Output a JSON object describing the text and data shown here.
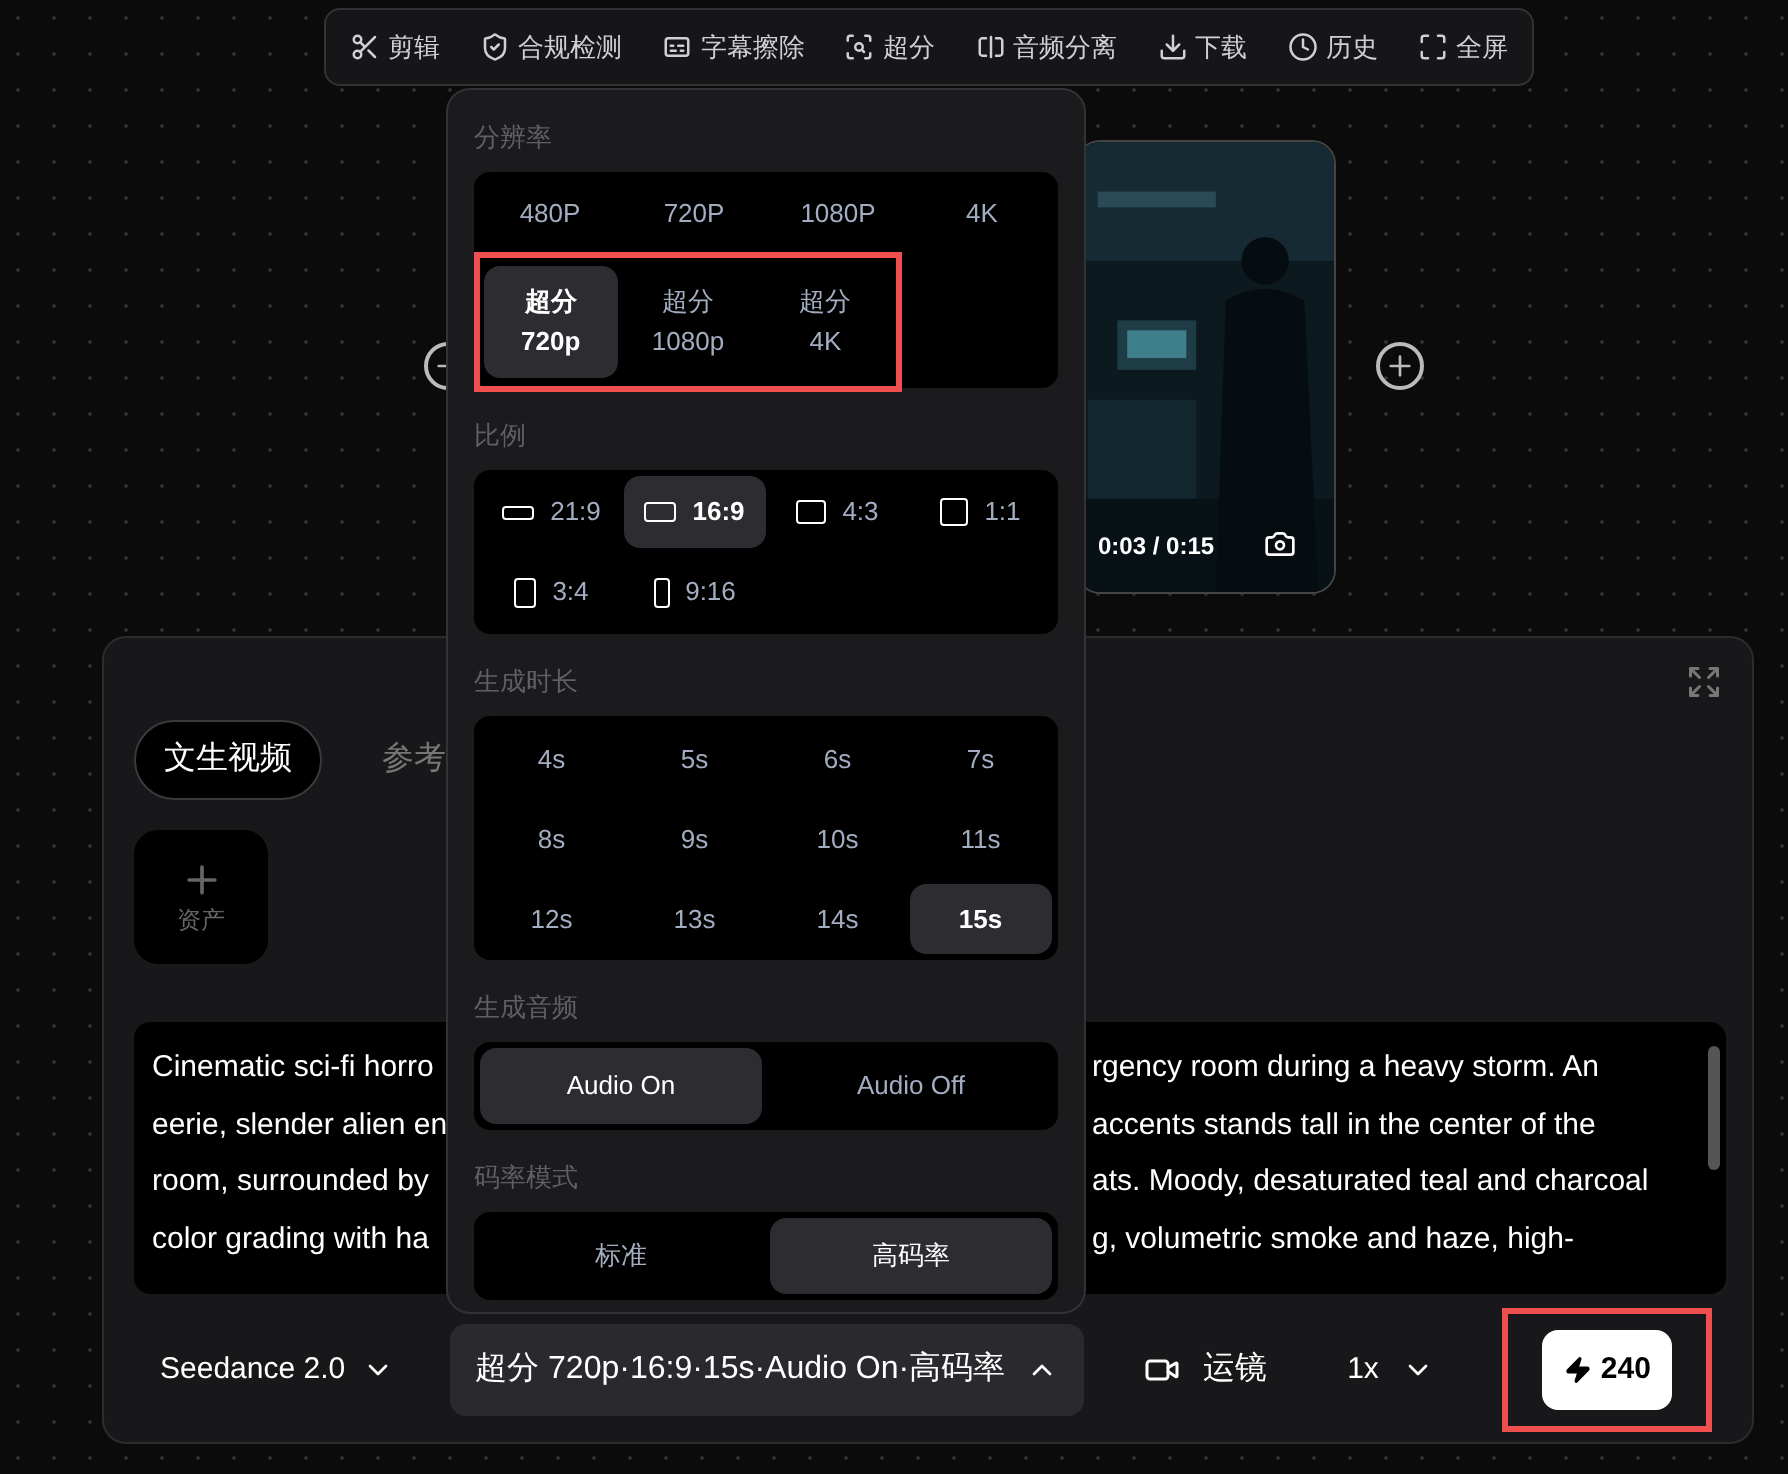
{
  "toolbar": [
    {
      "label": "剪辑"
    },
    {
      "label": "合规检测"
    },
    {
      "label": "字幕擦除"
    },
    {
      "label": "超分"
    },
    {
      "label": "音频分离"
    },
    {
      "label": "下载"
    },
    {
      "label": "历史"
    },
    {
      "label": "全屏"
    }
  ],
  "preview": {
    "time": "0:03 / 0:15"
  },
  "settings_menu": {
    "resolution": {
      "title": "分辨率",
      "options": [
        {
          "label": "480P",
          "selected": false
        },
        {
          "label": "720P",
          "selected": false
        },
        {
          "label": "1080P",
          "selected": false
        },
        {
          "label": "4K",
          "selected": false
        }
      ],
      "upscale": {
        "highlighted": true,
        "options": [
          {
            "label": "超分",
            "sublabel": "720p",
            "selected": true
          },
          {
            "label": "超分",
            "sublabel": "1080p",
            "selected": false
          },
          {
            "label": "超分",
            "sublabel": "4K",
            "selected": false
          }
        ]
      }
    },
    "aspect": {
      "title": "比例",
      "options": [
        {
          "label": "21:9",
          "selected": false
        },
        {
          "label": "16:9",
          "selected": true
        },
        {
          "label": "4:3",
          "selected": false
        },
        {
          "label": "1:1",
          "selected": false
        },
        {
          "label": "3:4",
          "selected": false
        },
        {
          "label": "9:16",
          "selected": false
        }
      ]
    },
    "duration": {
      "title": "生成时长",
      "options": [
        {
          "label": "4s",
          "selected": false
        },
        {
          "label": "5s",
          "selected": false
        },
        {
          "label": "6s",
          "selected": false
        },
        {
          "label": "7s",
          "selected": false
        },
        {
          "label": "8s",
          "selected": false
        },
        {
          "label": "9s",
          "selected": false
        },
        {
          "label": "10s",
          "selected": false
        },
        {
          "label": "11s",
          "selected": false
        },
        {
          "label": "12s",
          "selected": false
        },
        {
          "label": "13s",
          "selected": false
        },
        {
          "label": "14s",
          "selected": false
        },
        {
          "label": "15s",
          "selected": true
        }
      ]
    },
    "audio": {
      "title": "生成音频",
      "options": [
        {
          "label": "Audio On",
          "selected": true
        },
        {
          "label": "Audio Off",
          "selected": false
        }
      ]
    },
    "bitrate": {
      "title": "码率模式",
      "options": [
        {
          "label": "标准",
          "selected": false
        },
        {
          "label": "高码率",
          "selected": true
        }
      ]
    }
  },
  "mode_tabs": [
    {
      "label": "文生视频",
      "selected": true
    },
    {
      "label": "参考",
      "selected": false
    }
  ],
  "asset_button": {
    "label": "资产"
  },
  "prompt_lines": [
    {
      "left": "Cinematic sci-fi horro",
      "right": "rgency room during a heavy storm. An"
    },
    {
      "left": "eerie, slender alien en",
      "right": "accents stands tall in the center of the"
    },
    {
      "left": "room, surrounded by",
      "right": "ats. Moody, desaturated teal and charcoal"
    },
    {
      "left": "color grading with ha",
      "right": "g, volumetric smoke and haze, high-"
    }
  ],
  "bottom_bar": {
    "model": "Seedance 2.0",
    "settings_summary": "超分 720p·16:9·15s·Audio On·高码率",
    "camera": "运镜",
    "speed": "1x",
    "credits": {
      "value": "240",
      "highlighted": true
    }
  }
}
